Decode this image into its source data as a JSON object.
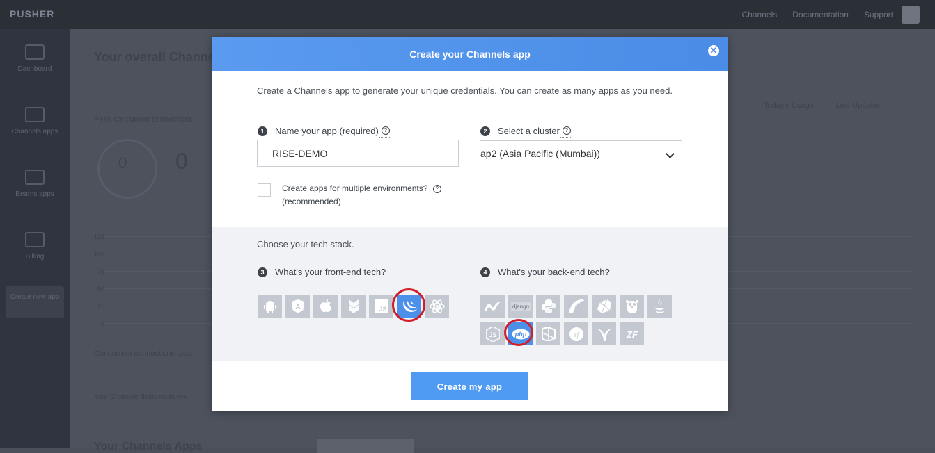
{
  "background": {
    "logo": "PUSHER",
    "top_links": [
      "Channels",
      "Documentation",
      "Support"
    ],
    "sidebar": [
      "Dashboard",
      "Channels apps",
      "Beams apps",
      "Billing"
    ],
    "create_new_app": "Create new app",
    "title": "Your overall Channels",
    "peak_label": "Peak concurrent connections",
    "gauge_value": "0",
    "big_number": "0",
    "tabs": [
      "Today's Usage",
      "Live Updates"
    ],
    "y_ticks": [
      "125",
      "100",
      "75",
      "50",
      "25",
      "0"
    ],
    "concurrent_note": "Concurrent connections toda",
    "bottom_note": "Your Channels limits reset eve",
    "bottom_title": "Your Channels Apps"
  },
  "modal": {
    "title": "Create your Channels app",
    "close_icon": "close-icon",
    "intro": "Create a Channels app to generate your unique credentials. You can create as many apps as you need.",
    "step1": {
      "num": "1",
      "label": "Name your app (required)"
    },
    "app_name_value": "RISE-DEMO",
    "step2": {
      "num": "2",
      "label": "Select a cluster"
    },
    "cluster_value": "ap2 (Asia Pacific (Mumbai))",
    "multi_env_label": "Create apps for multiple environments?",
    "multi_env_sub": "(recommended)",
    "multi_env_checked": false,
    "stack_intro": "Choose your tech stack.",
    "step3": {
      "num": "3",
      "label": "What's your front-end tech?"
    },
    "step4": {
      "num": "4",
      "label": "What's your back-end tech?"
    },
    "frontend": [
      "android",
      "angular",
      "ios",
      "backbone",
      "vanilla-js",
      "jquery",
      "react"
    ],
    "frontend_selected": "jquery",
    "backend": [
      "dotnet",
      "django",
      "python",
      "rails",
      "ruby",
      "go",
      "java",
      "node",
      "php",
      "laravel",
      "symfony",
      "yii",
      "zend"
    ],
    "backend_selected": "php",
    "js_text": "JS",
    "django_text": "django",
    "node_text": "JS",
    "php_text": "php",
    "sf_text": "sf",
    "zf_text": "ZF",
    "create_button": "Create my app",
    "accent": "#4a8ce6"
  }
}
